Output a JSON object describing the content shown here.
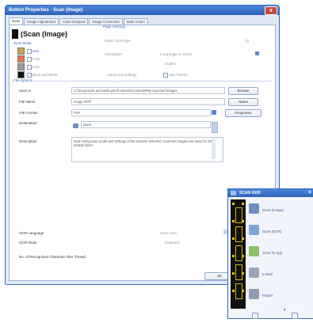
{
  "window": {
    "title": "Button Properties - Scan (Image)",
    "close": "x"
  },
  "tabs": [
    "Scan",
    "Image Adjustment",
    "Color Dropout",
    "Image Correction",
    "Multi Action"
  ],
  "panel": {
    "title": "(Scan (Image)",
    "scan_mode_link": "Scan Mode",
    "scan_modes": [
      {
        "label": "Auto",
        "color": "#c7a34a"
      },
      {
        "label": "Color",
        "color": "#e07a48"
      },
      {
        "label": "Gray",
        "color": "#9a9a9a"
      },
      {
        "label": "Black and White",
        "color": "#111111"
      }
    ],
    "page_settings_link": "Page Settings",
    "paper_size_label": "Paper Size/Type",
    "paper_size_value": "",
    "paper_size_suffix": "(2)",
    "orientation_label": "Orientation",
    "orientation_value": "Long Edge & Center",
    "duplex_label": "Duplex",
    "advanced_label": "Advanced Settings",
    "detect_label": "Use TWAIN",
    "file_options_link": "File Options",
    "save_in_label": "Save in",
    "save_in_value": "C:\\Documents and Settings\\All Users\\Documents\\My Scanned Images",
    "browse_label": "Browse",
    "file_name_label": "File Name",
    "file_name_value": "Image ####",
    "name_btn_label": "Name",
    "file_format_label": "File Format",
    "file_format_value": "PDF",
    "format_btn_label": "Properties",
    "destination_label": "Destination",
    "destination_value": "None",
    "description_label": "Description",
    "description_value": "Scan using scan mode and settings of the scanner selected. Scanned images are saved to the default folder.",
    "ocr_language_label": "OCR Language",
    "ocr_language_value": "",
    "ocr_layout_label": "Zone Area",
    "ocr_layout_value": "",
    "ocr_mode_label": "OCR Mode",
    "ocr_mode_value": "",
    "ocr_detect_label": "Detection",
    "ocr_detect_value": "",
    "recognized_label": "No. of Recognized Character After Thread",
    "ok_label": "OK"
  },
  "side_window": {
    "title": "SCAN 0000",
    "items": [
      {
        "label": "Scan (Image)",
        "icon": "scan-image-icon",
        "color": "#6f8fc4"
      },
      {
        "label": "Scan (OCR)",
        "icon": "scan-ocr-icon",
        "color": "#7fa4d6"
      },
      {
        "label": "Scan To App",
        "icon": "scan-to-app-icon",
        "color": "#8cc06a"
      },
      {
        "label": "E-Mail",
        "icon": "email-icon",
        "color": "#9aa6b6"
      },
      {
        "label": "Printer",
        "icon": "printer-icon",
        "color": "#8e9ab0"
      }
    ]
  },
  "colors": {
    "accent": "#3a6cc0",
    "link": "#3a66b8"
  }
}
